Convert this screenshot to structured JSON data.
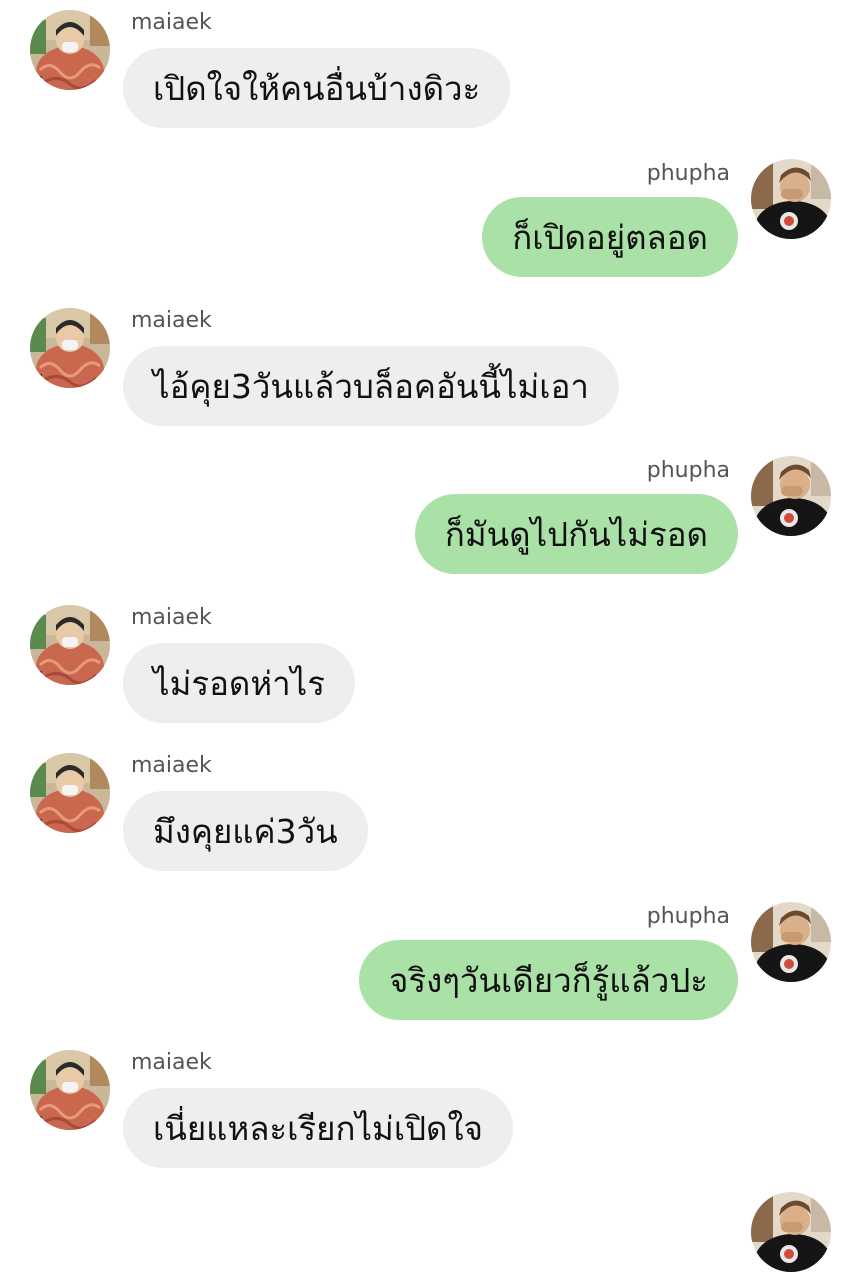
{
  "conversation": {
    "messages": [
      {
        "sender": "maiaek",
        "direction": "incoming",
        "text": "เปิดใจให้คนอื่นบ้างดิวะ"
      },
      {
        "sender": "phupha",
        "direction": "outgoing",
        "text": "ก็เปิดอยู่ตลอด"
      },
      {
        "sender": "maiaek",
        "direction": "incoming",
        "text": "ไอ้คุย3วันแล้วบล็อคอันนี้ไม่เอา"
      },
      {
        "sender": "phupha",
        "direction": "outgoing",
        "text": "ก็มันดูไปกันไม่รอด"
      },
      {
        "sender": "maiaek",
        "direction": "incoming",
        "text": "ไม่รอดห่าไร"
      },
      {
        "sender": "maiaek",
        "direction": "incoming",
        "text": "มึงคุยแค่3วัน"
      },
      {
        "sender": "phupha",
        "direction": "outgoing",
        "text": "จริงๆวันเดียวก็รู้แล้วปะ"
      },
      {
        "sender": "maiaek",
        "direction": "incoming",
        "text": "เนี่ยแหละเรียกไม่เปิดใจ"
      }
    ]
  },
  "colors": {
    "incoming_bubble": "#eeeeee",
    "outgoing_bubble": "#a9e1a6",
    "name_text": "#555555",
    "message_text": "#111111"
  },
  "icons": {
    "incoming_avatar": "avatar-photo-maiaek",
    "outgoing_avatar": "avatar-photo-phupha"
  }
}
